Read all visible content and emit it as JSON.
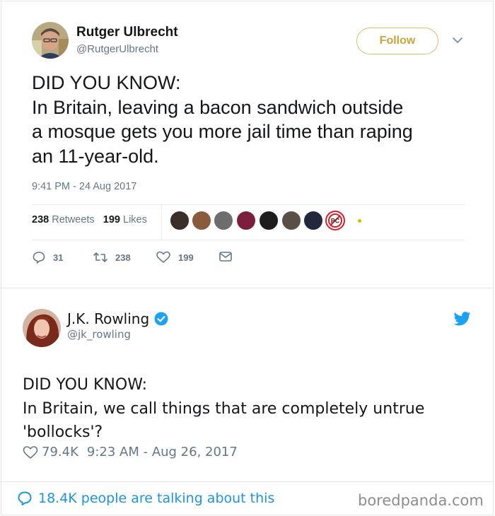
{
  "tweet1": {
    "author_name": "Rutger Ulbrecht",
    "author_handle": "@RutgerUlbrecht",
    "follow_label": "Follow",
    "text_lines": [
      "DID YOU KNOW:",
      "In Britain, leaving a bacon sandwich outside",
      "a mosque gets you more jail time than raping",
      "an 11-year-old."
    ],
    "timestamp": "9:41 PM - 24 Aug 2017",
    "retweets_count": "238",
    "retweets_label": "Retweets",
    "likes_count": "199",
    "likes_label": "Likes",
    "actions": {
      "replies": "31",
      "retweets": "238",
      "likes": "199"
    },
    "colors": {
      "follow": "#c9a43d"
    }
  },
  "tweet2": {
    "author_name": "J.K. Rowling",
    "author_handle": "@jk_rowling",
    "text_lines": [
      "DID YOU KNOW:",
      "In Britain, we call things that are completely untrue",
      "'bollocks'?"
    ],
    "likes": "79.4K",
    "timestamp": "9:23 AM - Aug 26, 2017",
    "talking": "18.4K people are talking about this",
    "colors": {
      "accent": "#1b95e0"
    }
  },
  "watermark": "boredpanda.com"
}
